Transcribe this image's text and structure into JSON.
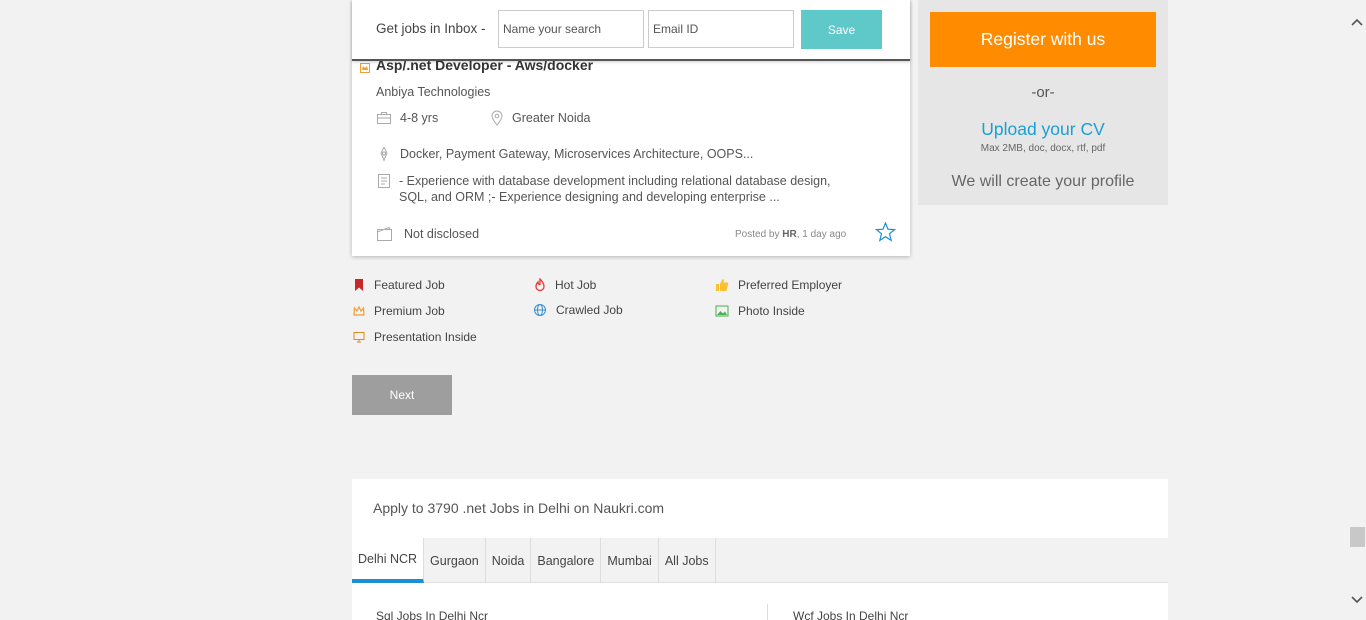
{
  "inbox": {
    "label": "Get jobs in Inbox -",
    "search_placeholder": "Name your search",
    "email_placeholder": "Email ID",
    "save_label": "Save"
  },
  "job": {
    "title": "Asp/.net Developer - Aws/docker",
    "company": "Anbiya Technologies",
    "experience": "4-8 yrs",
    "location": "Greater Noida",
    "skills": "Docker, Payment Gateway, Microservices Architecture, OOPS...",
    "description_line1": "- Experience with database development including relational database design,",
    "description_line2": "SQL, and ORM ;- Experience designing and developing enterprise ...",
    "salary": "Not disclosed",
    "posted_prefix": "Posted by",
    "posted_by": "HR",
    "posted_when": ", 1 day ago"
  },
  "legend": {
    "featured": "Featured Job",
    "hot": "Hot Job",
    "preferred": "Preferred Employer",
    "premium": "Premium Job",
    "crawled": "Crawled Job",
    "photo": "Photo Inside",
    "presentation": "Presentation Inside"
  },
  "pagination": {
    "next_label": "Next"
  },
  "sidebar": {
    "register_label": "Register with us",
    "or_label": "-or-",
    "upload_label": "Upload your CV",
    "upload_hint": "Max 2MB, doc, docx, rtf, pdf",
    "create_profile": "We will create your profile"
  },
  "apply": {
    "title": "Apply to 3790 .net Jobs in Delhi on Naukri.com",
    "tabs": [
      "Delhi NCR",
      "Gurgaon",
      "Noida",
      "Bangalore",
      "Mumbai",
      "All Jobs"
    ],
    "active_tab": "Delhi NCR",
    "links": [
      "Sql Jobs In Delhi Ncr",
      "Wcf Jobs In Delhi Ncr"
    ]
  },
  "colors": {
    "accent_teal": "#5fc9c9",
    "register_orange": "#ff8c00",
    "link_blue": "#1a9fd6",
    "tab_active_underline": "#1a8fd6"
  }
}
